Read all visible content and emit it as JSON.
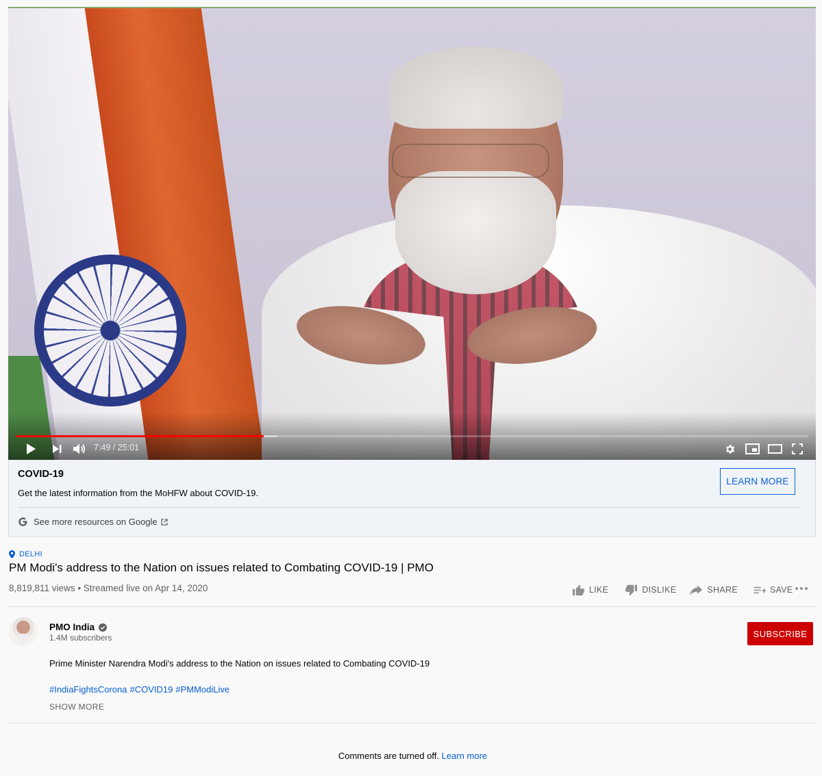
{
  "player": {
    "current_time": "7:49",
    "duration": "25:01",
    "time_display": "7:49 / 25:01",
    "played_fraction": 0.313,
    "buffered_fraction": 0.33,
    "controls": {
      "play": "play-icon",
      "next": "next-icon",
      "volume": "volume-icon",
      "settings": "gear-icon",
      "miniplayer": "miniplayer-icon",
      "theater": "theater-mode-icon",
      "fullscreen": "fullscreen-icon"
    }
  },
  "info_panel": {
    "title": "COVID-19",
    "description": "Get the latest information from the MoHFW about COVID-19.",
    "learn_more_label": "LEARN MORE",
    "google_link": "See more resources on Google"
  },
  "video": {
    "location": "DELHI",
    "title": "PM Modi's address to the Nation on issues related to Combating COVID-19 | PMO",
    "views": "8,819,811 views",
    "separator": "•",
    "streamed": "Streamed live on Apr 14, 2020",
    "meta_line": "8,819,811 views • Streamed live on Apr 14, 2020"
  },
  "actions": {
    "like": "LIKE",
    "dislike": "DISLIKE",
    "share": "SHARE",
    "save": "SAVE"
  },
  "channel": {
    "name": "PMO India",
    "subscribers": "1.4M subscribers",
    "subscribe_label": "SUBSCRIBE"
  },
  "description": {
    "text": "Prime Minister Narendra Modi's address to the Nation on issues related to Combating COVID-19",
    "hashtags": [
      "#IndiaFightsCorona",
      "#COVID19",
      "#PMModiLive"
    ],
    "show_more": "SHOW MORE"
  },
  "comments": {
    "off_text": "Comments are turned off.",
    "learn_more": "Learn more"
  },
  "colors": {
    "accent_blue": "#065fd4",
    "subscribe_red": "#cc0000",
    "progress_red": "#ff0000",
    "panel_bg": "#f0f4f9",
    "page_bg": "#f9f9f9"
  }
}
